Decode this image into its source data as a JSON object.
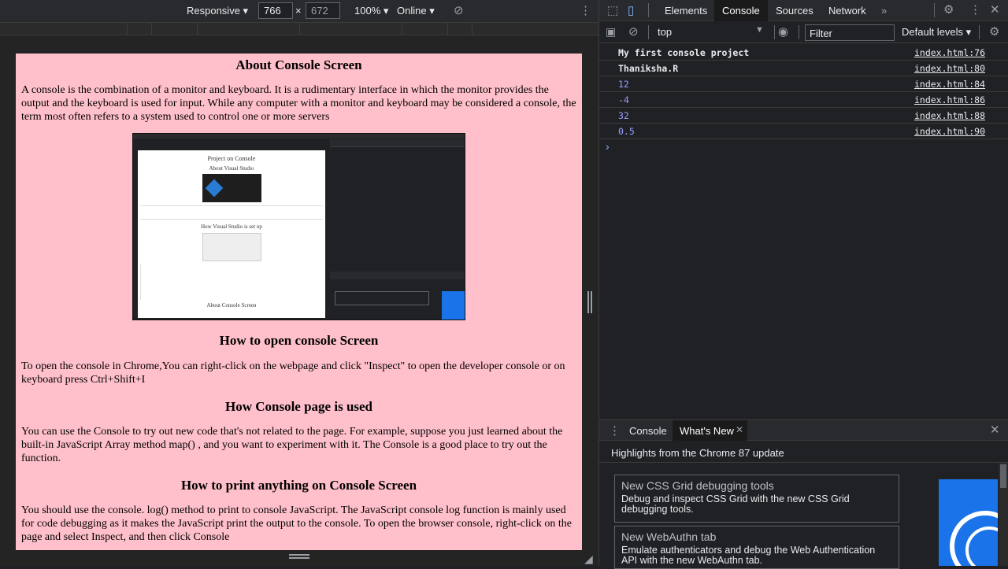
{
  "device_toolbar": {
    "mode": "Responsive",
    "width": "766",
    "times": "×",
    "height": "672",
    "zoom": "100%",
    "network": "Online"
  },
  "page": {
    "h1": "About Console Screen",
    "p1": "A console is the combination of a monitor and keyboard. It is a rudimentary interface in which the monitor provides the output and the keyboard is used for input. While any computer with a monitor and keyboard may be considered a console, the term most often refers to a system used to control one or more servers",
    "h2": "How to open console Screen",
    "p2": "To open the console in Chrome,You can right-click on the webpage and click \"Inspect\" to open the developer console or on keyboard press Ctrl+Shift+I",
    "h3": "How Console page is used",
    "p3": "You can use the Console to try out new code that's not related to the page. For example, suppose you just learned about the built-in JavaScript Array method map() , and you want to experiment with it. The Console is a good place to try out the function.",
    "h4": "How to print anything on Console Screen",
    "p4": "You should use the console. log() method to print to console JavaScript. The JavaScript console log function is mainly used for code debugging as it makes the JavaScript print the output to the console. To open the browser console, right-click on the page and select Inspect, and then click Console",
    "screenshot": {
      "title": "Project on Console",
      "subtitle": "About Visual Studio",
      "setup_heading": "How Visual Studio is set up",
      "console_heading": "About Console Screen"
    }
  },
  "devtools": {
    "tabs": [
      "Elements",
      "Console",
      "Sources",
      "Network"
    ],
    "more": "»",
    "context": "top",
    "filter_placeholder": "Filter",
    "levels": "Default levels",
    "messages": [
      {
        "text": "My first console project",
        "source": "index.html:76",
        "color": "#e8eaed"
      },
      {
        "text": "Thaniksha.R",
        "source": "index.html:80",
        "color": "#e8eaed"
      },
      {
        "text": "12",
        "source": "index.html:84",
        "color": "#9a9eff"
      },
      {
        "text": "-4",
        "source": "index.html:86",
        "color": "#9a9eff"
      },
      {
        "text": "32",
        "source": "index.html:88",
        "color": "#9a9eff"
      },
      {
        "text": "0.5",
        "source": "index.html:90",
        "color": "#9a9eff"
      }
    ],
    "prompt": "›",
    "drawer": {
      "tab1": "Console",
      "tab2": "What's New",
      "highlights": "Highlights from the Chrome 87 update",
      "cards": [
        {
          "title": "New CSS Grid debugging tools",
          "desc": "Debug and inspect CSS Grid with the new CSS Grid debugging tools."
        },
        {
          "title": "New WebAuthn tab",
          "desc": "Emulate authenticators and debug the Web Authentication API with the new WebAuthn tab."
        }
      ]
    }
  }
}
